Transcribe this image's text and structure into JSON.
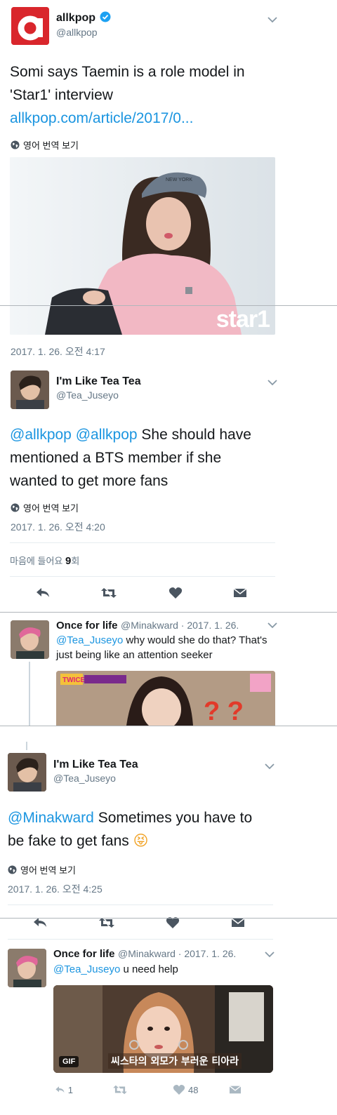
{
  "tweet1": {
    "name": "allkpop",
    "handle": "@allkpop",
    "text_plain": "Somi says Taemin is a role model in 'Star1' interview ",
    "text_link": "allkpop.com/article/2017/0...",
    "translate": "영어 번역 보기",
    "image_watermark": "star1",
    "image_cap_text": "NEW YORK",
    "timestamp": "2017. 1. 26. 오전 4:17"
  },
  "tweet2": {
    "name": "I'm Like Tea Tea",
    "handle": "@Tea_Juseyo",
    "mention1": "@allkpop",
    "mention2": "@allkpop",
    "text": " She should have mentioned a BTS member if she wanted to get more fans",
    "translate": "영어 번역 보기",
    "timestamp": "2017. 1. 26. 오전 4:20",
    "likes_label_pre": "마음에 들어요 ",
    "likes_count": "9",
    "likes_label_post": "회"
  },
  "reply1": {
    "name": "Once for life",
    "meta": "@Minakward · 2017. 1. 26.",
    "mention": "@Tea_Juseyo",
    "text": " why would she do that? That's just being like an attention seeker",
    "image_badge": "TWICE"
  },
  "tweet3": {
    "name": "I'm Like Tea Tea",
    "handle": "@Tea_Juseyo",
    "mention": "@Minakward",
    "text": " Sometimes you have to be fake to get fans ",
    "emoji": "😝",
    "translate": "영어 번역 보기",
    "timestamp": "2017. 1. 26. 오전 4:25"
  },
  "reply2": {
    "name": "Once for life",
    "meta": "@Minakward · 2017. 1. 26.",
    "mention": "@Tea_Juseyo",
    "text": " u need help",
    "gif_label": "GIF",
    "caption": "씨스타의 외모가 부러운 티아라",
    "reply_count": "1",
    "like_count": "48"
  },
  "colors": {
    "link": "#1b95e0",
    "brand_red": "#d9262c",
    "verified": "#1da1f2"
  },
  "icons": [
    "globe-icon",
    "chevron-down-icon",
    "reply-icon",
    "retweet-icon",
    "heart-icon",
    "message-icon",
    "verified-badge-icon"
  ]
}
